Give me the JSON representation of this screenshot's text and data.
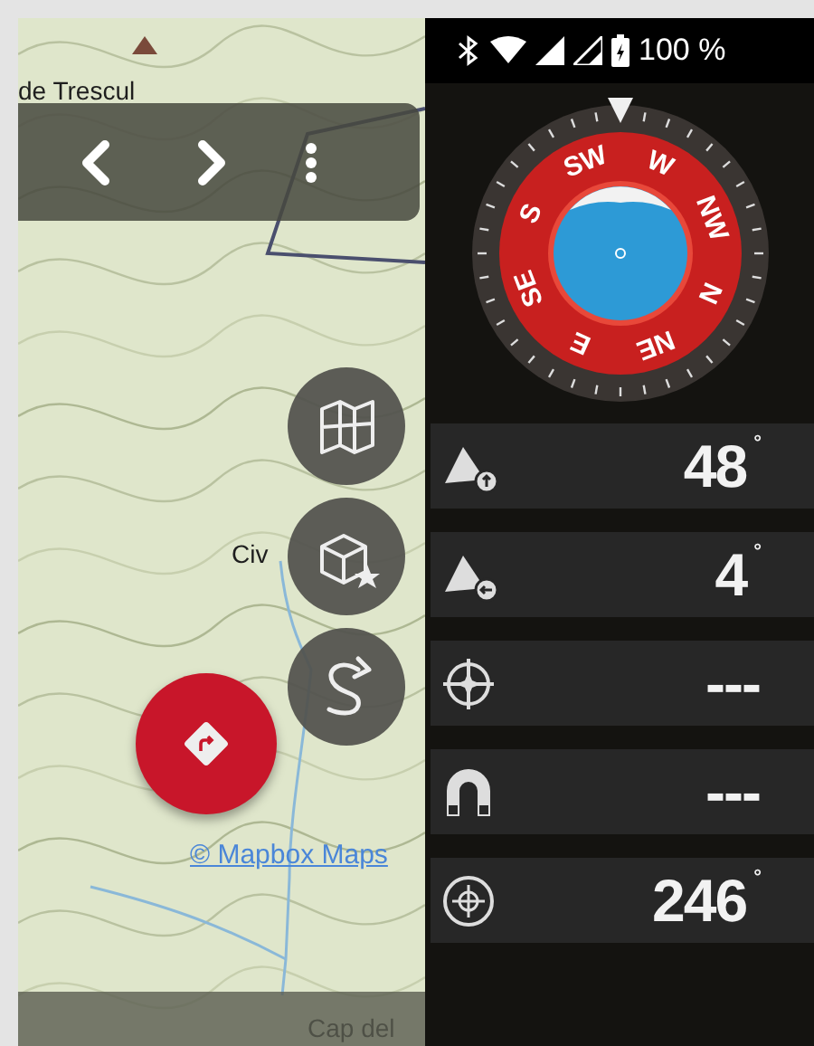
{
  "map": {
    "place_labels": [
      "de Trescul",
      "Civ",
      "Cap del"
    ],
    "attribution": "© Mapbox Maps",
    "toolbar": [
      {
        "kind": "back"
      },
      {
        "kind": "forward"
      },
      {
        "kind": "menu"
      }
    ],
    "side_buttons": [
      {
        "kind": "map"
      },
      {
        "kind": "waypoint"
      },
      {
        "kind": "route"
      }
    ],
    "main_button": {
      "kind": "navigate"
    }
  },
  "status_bar": {
    "battery_text": "100 %"
  },
  "compass": {
    "directions": [
      "N",
      "NE",
      "E",
      "SE",
      "S",
      "SW",
      "W",
      "NW"
    ]
  },
  "readings": [
    {
      "kind": "incline-up",
      "value": "48",
      "unit": "°"
    },
    {
      "kind": "incline-side",
      "value": "4",
      "unit": "°"
    },
    {
      "kind": "crosshair",
      "value": "---"
    },
    {
      "kind": "magnet",
      "value": "---"
    },
    {
      "kind": "compass",
      "value": "246",
      "unit": "°"
    }
  ]
}
